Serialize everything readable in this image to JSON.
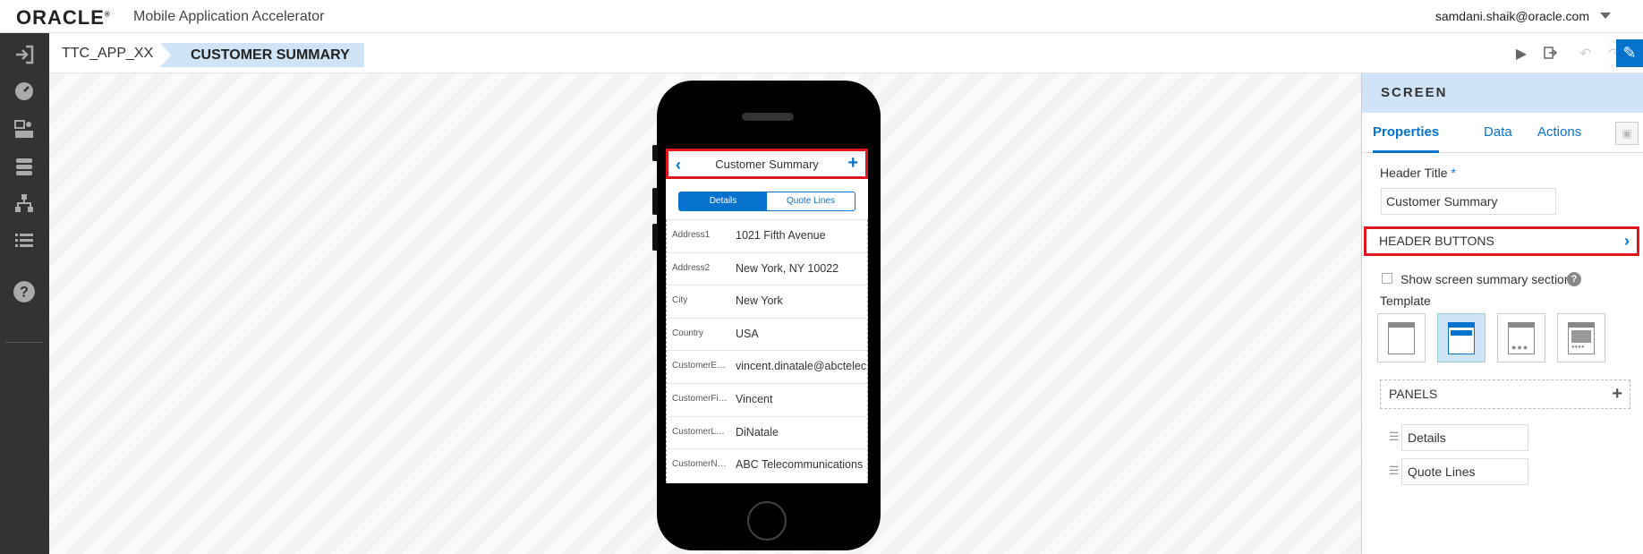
{
  "topbar": {
    "logo": "ORACLE",
    "logo_mark": "®",
    "app_title": "Mobile Application Accelerator",
    "user": "samdani.shaik@oracle.com"
  },
  "nav": {
    "icons": [
      "sign-in-icon",
      "dashboard-icon",
      "checklist-icon",
      "database-icon",
      "sitemap-icon",
      "list-icon",
      "help-icon"
    ]
  },
  "breadcrumb": {
    "app": "TTC_APP_XX",
    "screen": "CUSTOMER SUMMARY"
  },
  "phone": {
    "header_title": "Customer Summary",
    "tabs": [
      "Details",
      "Quote Lines"
    ],
    "rows": [
      {
        "label": "Address1",
        "value": "1021 Fifth Avenue"
      },
      {
        "label": "Address2",
        "value": "New York, NY 10022"
      },
      {
        "label": "City",
        "value": "New York"
      },
      {
        "label": "Country",
        "value": "USA"
      },
      {
        "label": "CustomerEm...",
        "value": "vincent.dinatale@abctelecom"
      },
      {
        "label": "CustomerFir...",
        "value": "Vincent"
      },
      {
        "label": "CustomerLa...",
        "value": "DiNatale"
      },
      {
        "label": "CustomerNa...",
        "value": "ABC Telecommunications"
      }
    ]
  },
  "panel": {
    "title": "SCREEN",
    "tabs": [
      "Properties",
      "Data",
      "Actions"
    ],
    "header_title_label": "Header Title",
    "header_title_value": "Customer Summary",
    "header_buttons": "HEADER BUTTONS",
    "summary_checkbox": "Show screen summary section",
    "template_label": "Template",
    "panels_label": "PANELS",
    "panels": [
      "Details",
      "Quote Lines"
    ]
  },
  "colors": {
    "accent": "#0572ce",
    "highlight": "#e0161f",
    "nav_bg": "#333333",
    "selected_bg": "#cfe4f6"
  }
}
